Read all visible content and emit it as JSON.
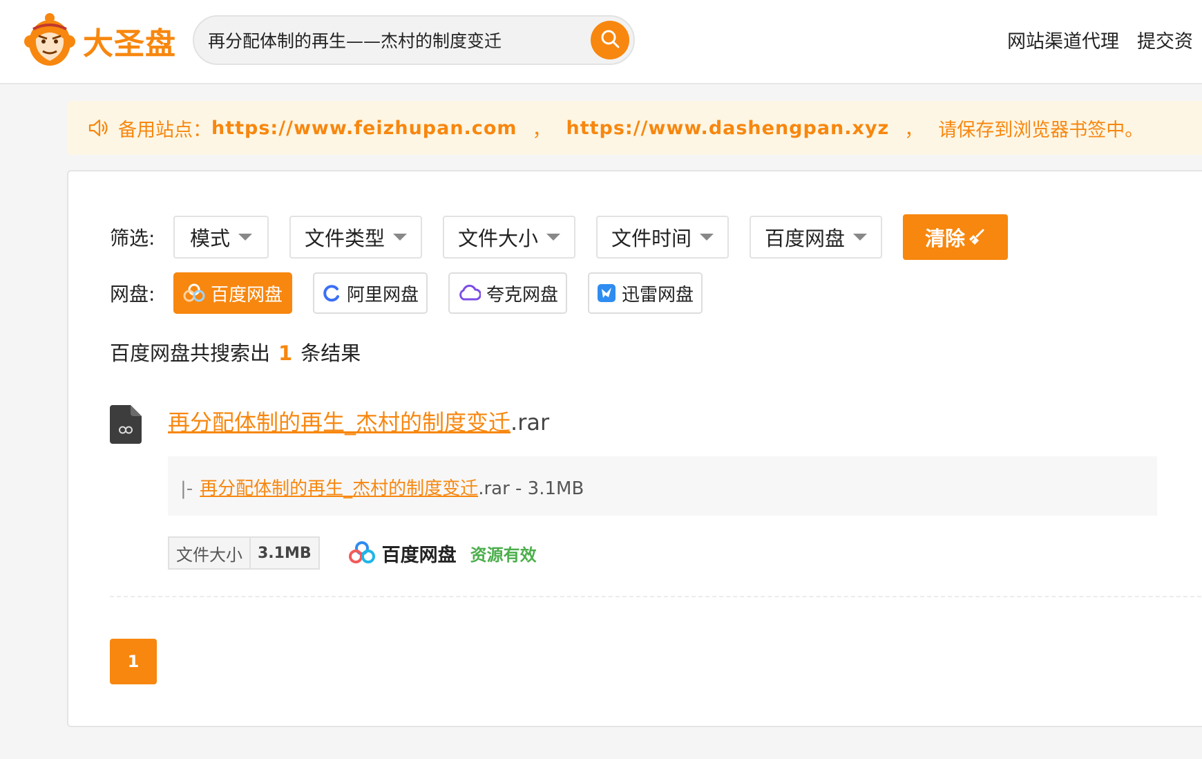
{
  "header": {
    "logo_text": "大圣盘",
    "search": {
      "value": "再分配体制的再生——杰村的制度变迁"
    },
    "nav": [
      "网站渠道代理",
      "提交资"
    ]
  },
  "notice": {
    "prefix": "备用站点：",
    "url1": "https://www.feizhupan.com",
    "sep": "，",
    "url2": "https://www.dashengpan.xyz",
    "suffix": "请保存到浏览器书签中。"
  },
  "filters": {
    "label": "筛选:",
    "dropdowns": [
      "模式",
      "文件类型",
      "文件大小",
      "文件时间",
      "百度网盘"
    ],
    "clear_label": "清除"
  },
  "drives": {
    "label": "网盘:",
    "items": [
      {
        "label": "百度网盘",
        "active": true
      },
      {
        "label": "阿里网盘",
        "active": false
      },
      {
        "label": "夸克网盘",
        "active": false
      },
      {
        "label": "迅雷网盘",
        "active": false
      }
    ]
  },
  "results": {
    "count_prefix": "百度网盘共搜索出",
    "count": "1",
    "count_suffix": "条结果",
    "items": [
      {
        "title_hl1": "再分配体制的再生",
        "title_sep": "_",
        "title_hl2": "杰村的制度变迁",
        "title_ext": ".rar",
        "sub_prefix": "|-",
        "sub_hl1": "再分配体制的再生",
        "sub_sep": "_",
        "sub_hl2": "杰村的制度变迁",
        "sub_ext": ".rar",
        "sub_size": " - 3.1MB",
        "size_label": "文件大小",
        "size_value": "3.1MB",
        "disk": "百度网盘",
        "status": "资源有效"
      }
    ]
  },
  "pagination": {
    "current": "1"
  },
  "colors": {
    "accent": "#f7870f",
    "notice_bg": "#fdf6e4",
    "valid": "#4cae4c"
  }
}
